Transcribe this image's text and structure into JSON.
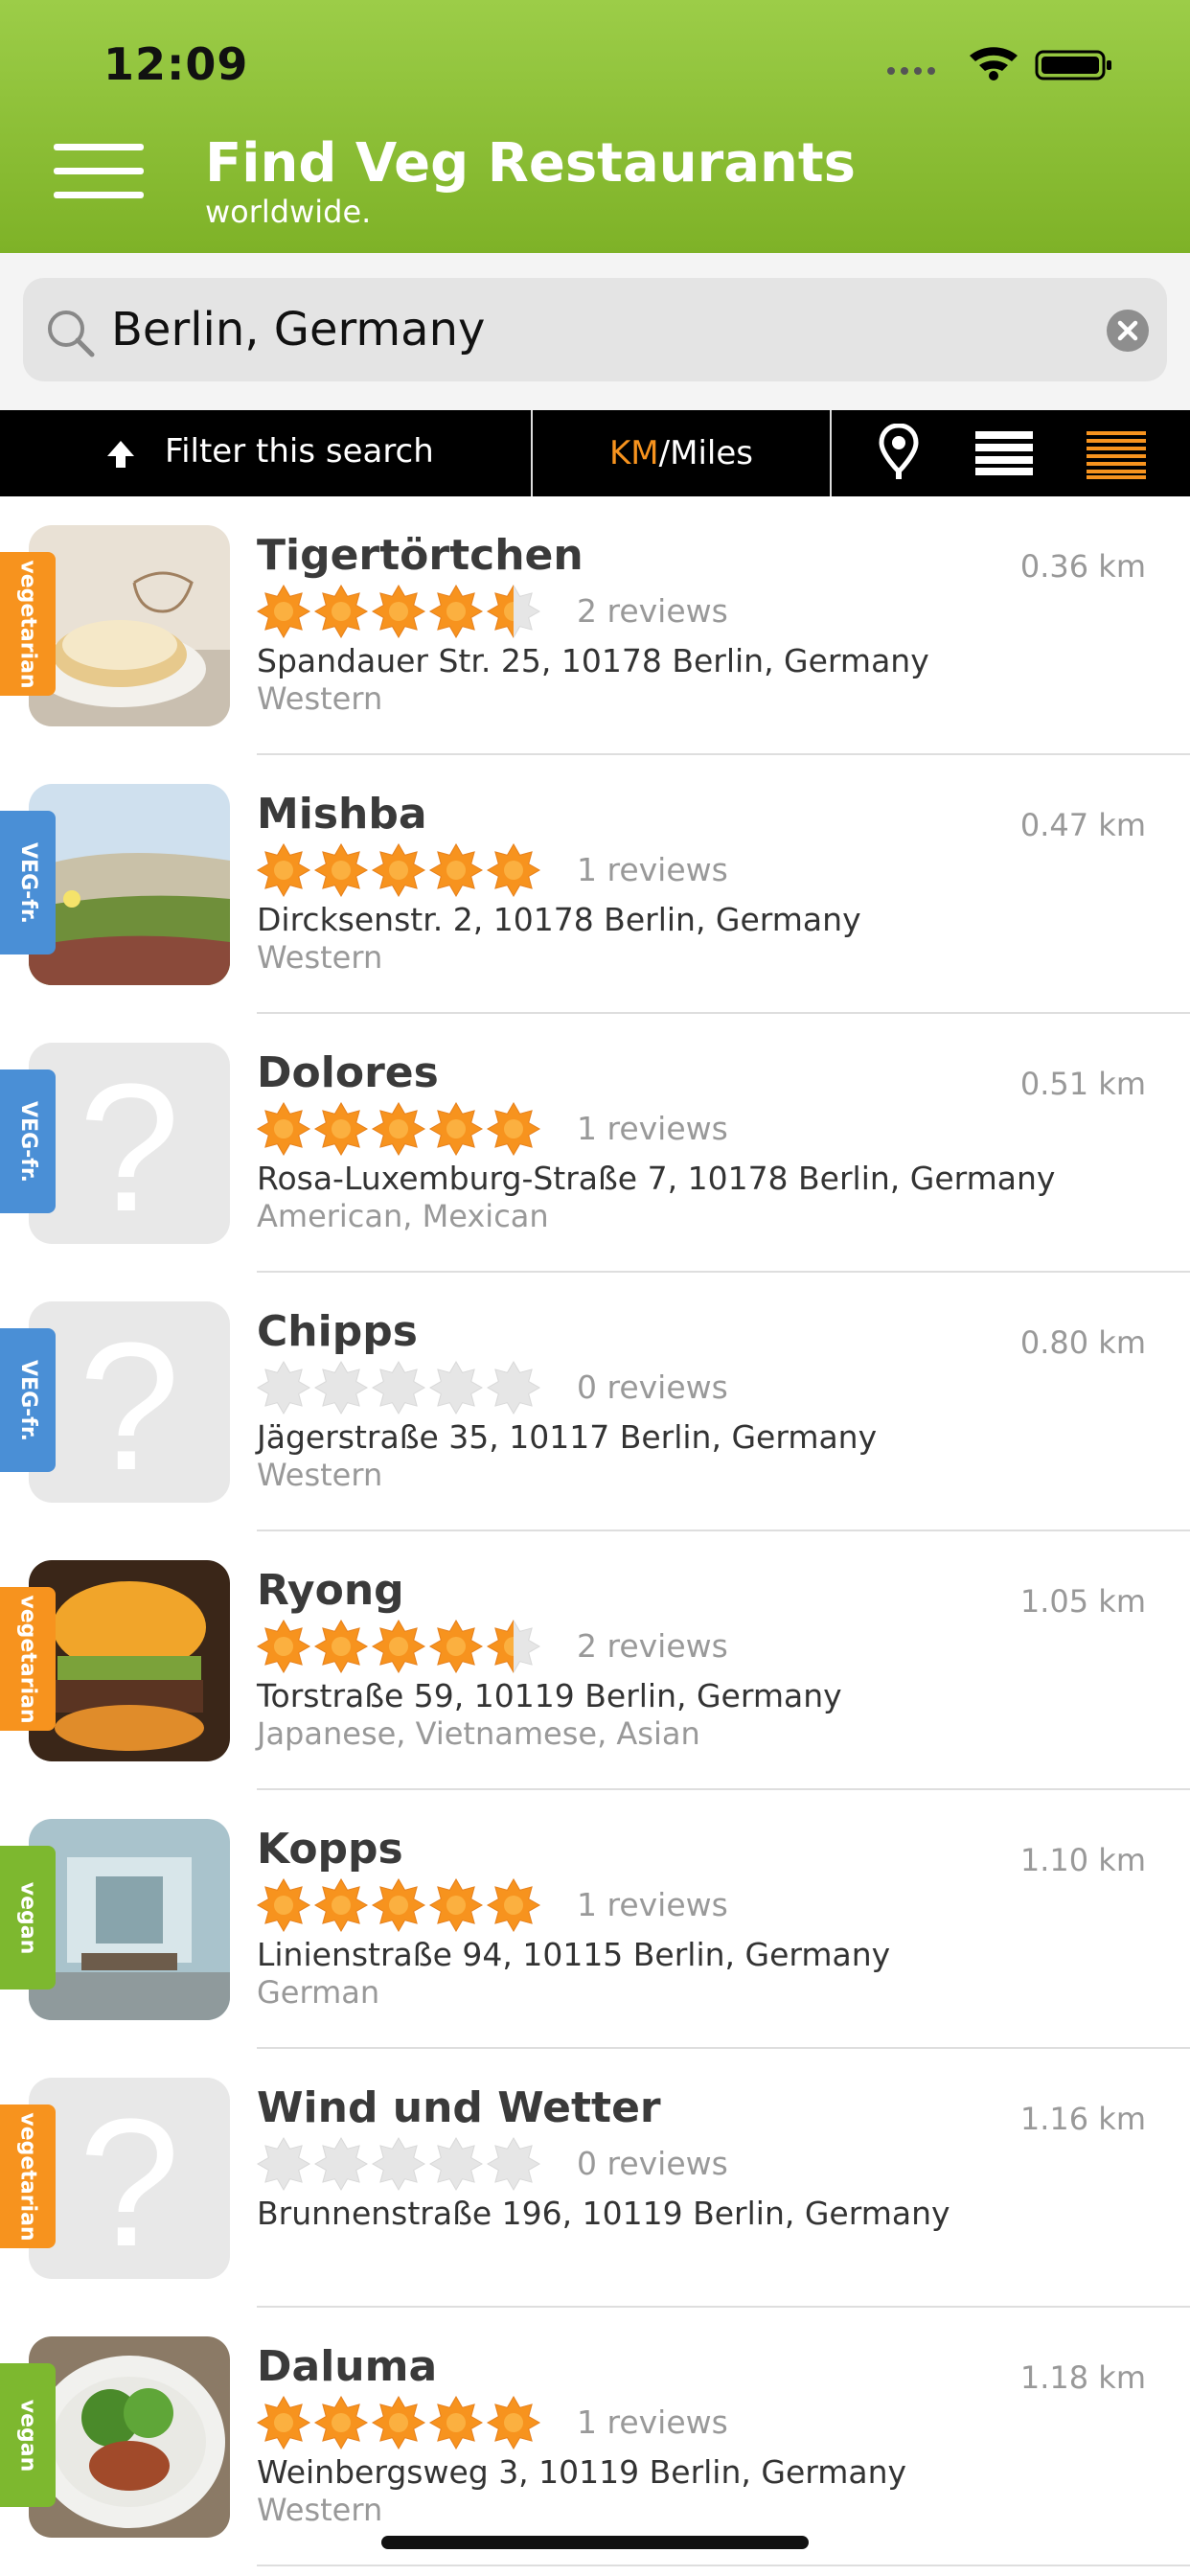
{
  "status_bar": {
    "time": "12:09"
  },
  "header": {
    "title": "Find Veg Restaurants",
    "subtitle": "worldwide.",
    "menu_icon": "hamburger-menu-icon",
    "background_color": "#8bc136"
  },
  "search": {
    "value": "Berlin, Germany"
  },
  "toolbar": {
    "filter_label": "Filter this search",
    "unit_km": "KM",
    "unit_separator": "/",
    "unit_miles": "Miles",
    "accent_color": "#f7931e"
  },
  "restaurants": [
    {
      "name": "Tigertörtchen",
      "rating": 4.5,
      "reviews": "2 reviews",
      "address": "Spandauer Str. 25, 10178 Berlin, Germany",
      "cuisine": "Western",
      "distance": "0.36 km",
      "tag": "vegetarian",
      "image": "cake-photo"
    },
    {
      "name": "Mishba",
      "rating": 5,
      "reviews": "1 reviews",
      "address": "Dircksenstr. 2, 10178 Berlin, Germany",
      "cuisine": "Western",
      "distance": "0.47 km",
      "tag": "VEG-fr.",
      "image": "dunes-photo"
    },
    {
      "name": "Dolores",
      "rating": 5,
      "reviews": "1 reviews",
      "address": "Rosa-Luxemburg-Straße 7, 10178 Berlin, Germany",
      "cuisine": "American, Mexican",
      "distance": "0.51 km",
      "tag": "VEG-fr.",
      "image": "placeholder"
    },
    {
      "name": "Chipps",
      "rating": 0,
      "reviews": "0 reviews",
      "address": "Jägerstraße 35, 10117 Berlin, Germany",
      "cuisine": "Western",
      "distance": "0.80 km",
      "tag": "VEG-fr.",
      "image": "placeholder"
    },
    {
      "name": "Ryong",
      "rating": 4.5,
      "reviews": "2 reviews",
      "address": "Torstraße 59, 10119 Berlin, Germany",
      "cuisine": "Japanese, Vietnamese, Asian",
      "distance": "1.05 km",
      "tag": "vegetarian",
      "image": "burger-photo"
    },
    {
      "name": "Kopps",
      "rating": 5,
      "reviews": "1 reviews",
      "address": "Linienstraße 94, 10115 Berlin, Germany",
      "cuisine": "German",
      "distance": "1.10 km",
      "tag": "vegan",
      "image": "interior-photo"
    },
    {
      "name": "Wind und Wetter",
      "rating": 0,
      "reviews": "0 reviews",
      "address": "Brunnenstraße 196, 10119 Berlin, Germany",
      "cuisine": "",
      "distance": "1.16 km",
      "tag": "vegetarian",
      "image": "placeholder"
    },
    {
      "name": "Daluma",
      "rating": 5,
      "reviews": "1 reviews",
      "address": "Weinbergsweg 3, 10119 Berlin, Germany",
      "cuisine": "Western",
      "distance": "1.18 km",
      "tag": "vegan",
      "image": "salad-photo"
    }
  ],
  "tag_colors": {
    "vegetarian": "#f7931e",
    "VEG-fr.": "#4a8fd6",
    "vegan": "#7db82f"
  },
  "star_colors": {
    "filled": "#f7931e",
    "empty": "#e6e6e6"
  }
}
